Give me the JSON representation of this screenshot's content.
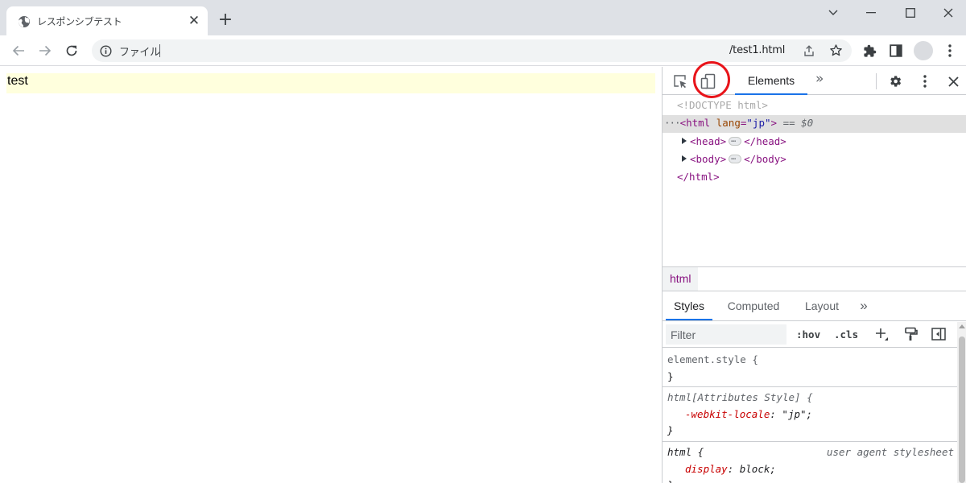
{
  "browser": {
    "tab": {
      "title": "レスポンシブテスト",
      "close_glyph": "✕"
    },
    "newtab_glyph": "+",
    "window_controls": [
      "chevron-down-icon",
      "minimize-icon",
      "maximize-icon",
      "close-icon"
    ],
    "toolbar": {
      "scheme_label": "ファイル",
      "url_path": "/test1.html",
      "icons": [
        "back-icon",
        "forward-icon",
        "reload-icon",
        "info-icon",
        "share-icon",
        "star-icon",
        "extensions-icon",
        "sidepanel-icon",
        "avatar",
        "menu-dots-icon"
      ]
    }
  },
  "page": {
    "text": "test",
    "highlight_color": "#ffffdd"
  },
  "devtools": {
    "top_tabs": {
      "elements_label": "Elements",
      "more_glyph": "»"
    },
    "dom": {
      "doctype": "<!DOCTYPE html>",
      "dots": "···",
      "html_open_tag": "<html",
      "html_attr_name": "lang",
      "html_attr_eq": "=",
      "html_attr_value": "\"jp\"",
      "html_open_close": ">",
      "eq_sel": "== $0",
      "head_open": "<head>",
      "head_close": "</head>",
      "body_open": "<body>",
      "body_close": "</body>",
      "html_close": "</html>"
    },
    "breadcrumb": "html",
    "styles_tabs": {
      "styles": "Styles",
      "computed": "Computed",
      "layout": "Layout",
      "more_glyph": "»"
    },
    "filter": {
      "placeholder": "Filter",
      "hov": ":hov",
      "cls": ".cls"
    },
    "rules": {
      "r1_selector": "element.style {",
      "r1_close": "}",
      "r2_selector": "html[Attributes Style] {",
      "r2_prop": "-webkit-locale",
      "r2_colon": ": ",
      "r2_val": "\"jp\";",
      "r2_close": "}",
      "r3_selector": "html {",
      "r3_source": "user agent stylesheet",
      "r3_prop": "display",
      "r3_colon": ": ",
      "r3_val": "block;",
      "r3_close": "}"
    },
    "annotation_color": "#e8141a",
    "accent_color": "#1a73e8"
  }
}
